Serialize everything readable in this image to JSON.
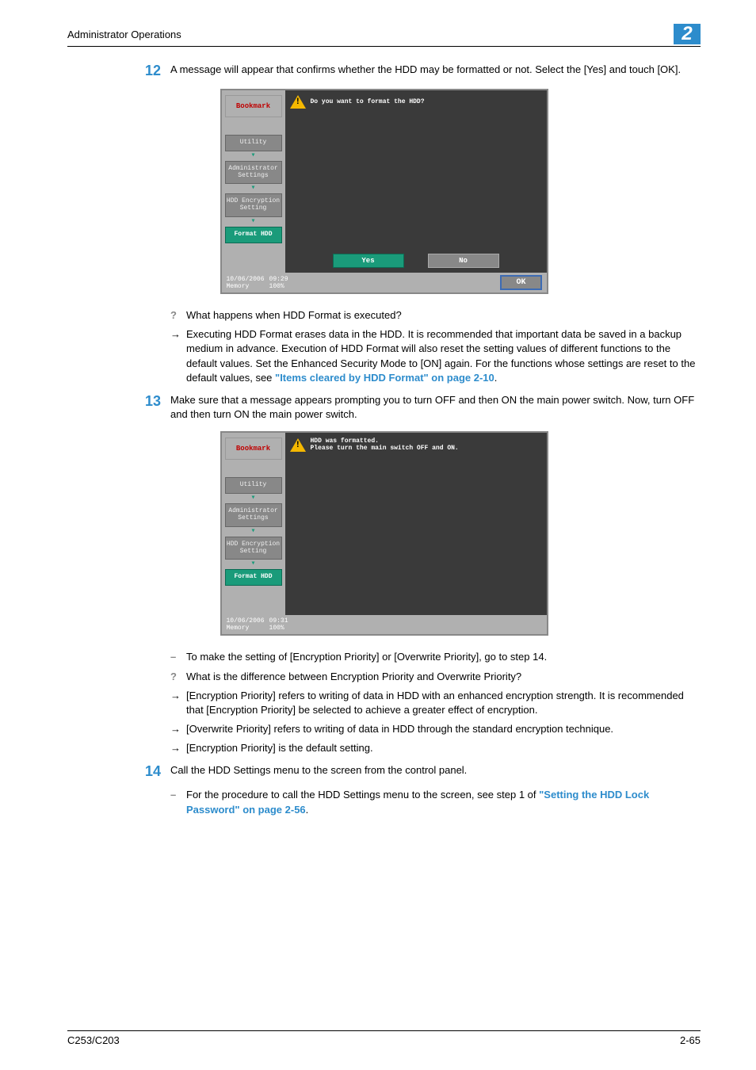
{
  "header": {
    "title": "Administrator Operations",
    "chapter": "2"
  },
  "steps": [
    {
      "num": "12",
      "text": "A message will appear that confirms whether the HDD may be formatted or not. Select the [Yes] and touch [OK]."
    },
    {
      "num": "13",
      "text": "Make sure that a message appears prompting you to turn OFF and then ON the main power switch. Now, turn OFF and then turn ON the main power switch."
    },
    {
      "num": "14",
      "text": "Call the HDD Settings menu to the screen from the control panel."
    }
  ],
  "notes12": {
    "q": "What happens when HDD Format is executed?",
    "a_pre": "Executing HDD Format erases data in the HDD. It is recommended that important data be saved in a backup medium in advance. Execution of HDD Format will also reset the setting values of different functions to the default values. Set the Enhanced Security Mode to [ON] again. For the functions whose settings are reset to the default values, see ",
    "a_link": "\"Items cleared by HDD Format\" on page 2-10",
    "a_post": "."
  },
  "notes13": {
    "dash": "To make the setting of [Encryption Priority] or [Overwrite Priority], go to step 14.",
    "q": "What is the difference between Encryption Priority and Overwrite Priority?",
    "a1": "[Encryption Priority] refers to writing of data in HDD with an enhanced encryption strength. It is recommended that [Encryption Priority] be selected to achieve a greater effect of encryption.",
    "a2": "[Overwrite Priority] refers to writing of data in HDD through the standard encryption technique.",
    "a3": "[Encryption Priority] is the default setting."
  },
  "notes14": {
    "dash_pre": "For the procedure to call the HDD Settings menu to the screen, see step 1 of ",
    "dash_link": "\"Setting the HDD Lock Password\" on page 2-56",
    "dash_post": "."
  },
  "screen1": {
    "bookmark": "Bookmark",
    "crumbs": [
      "Utility",
      "Administrator Settings",
      "HDD Encryption Setting",
      "Format HDD"
    ],
    "message": "Do you want to format the HDD?",
    "yes": "Yes",
    "no": "No",
    "date": "10/06/2006",
    "time": "09:29",
    "mem_label": "Memory",
    "mem_val": "100%",
    "ok": "OK"
  },
  "screen2": {
    "bookmark": "Bookmark",
    "crumbs": [
      "Utility",
      "Administrator Settings",
      "HDD Encryption Setting",
      "Format HDD"
    ],
    "msg1": "HDD was formatted.",
    "msg2": "Please turn the main switch OFF and ON.",
    "date": "10/06/2006",
    "time": "09:31",
    "mem_label": "Memory",
    "mem_val": "100%"
  },
  "footer": {
    "model": "C253/C203",
    "page": "2-65"
  }
}
